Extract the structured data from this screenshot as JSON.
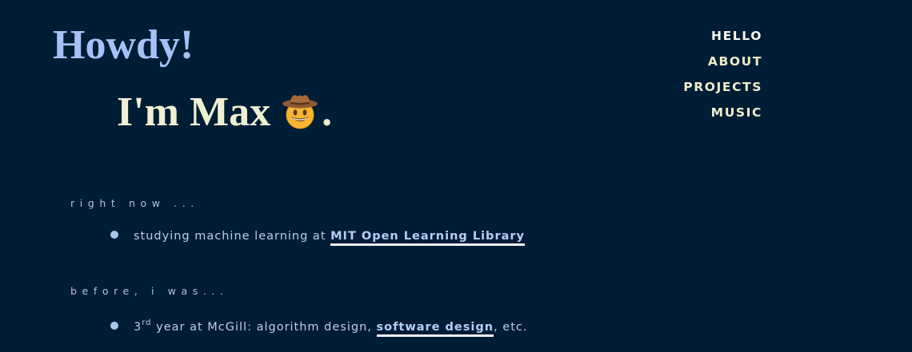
{
  "hero": {
    "greeting": "Howdy!",
    "intro": "I'm Max",
    "emoji_icon": "cowboy-hat-face-icon",
    "period": "."
  },
  "nav": {
    "items": [
      {
        "label": "HELLO"
      },
      {
        "label": "ABOUT"
      },
      {
        "label": "PROJECTS"
      },
      {
        "label": "MUSIC"
      }
    ]
  },
  "sections": {
    "now": {
      "label": "right now ...",
      "item_text": "studying machine learning at ",
      "item_link": "MIT Open Learning Library"
    },
    "before": {
      "label": "before, i was...",
      "ordinal_number": "3",
      "ordinal_suffix": "rd",
      "text_a": " year at McGill: algorithm design, ",
      "link": "software design",
      "text_b": ", etc."
    }
  },
  "colors": {
    "background": "#001d36",
    "greeting": "#a6c1f6",
    "intro": "#eef0d2",
    "nav": "#eceec8",
    "link_underline": "#f4f4f4"
  }
}
